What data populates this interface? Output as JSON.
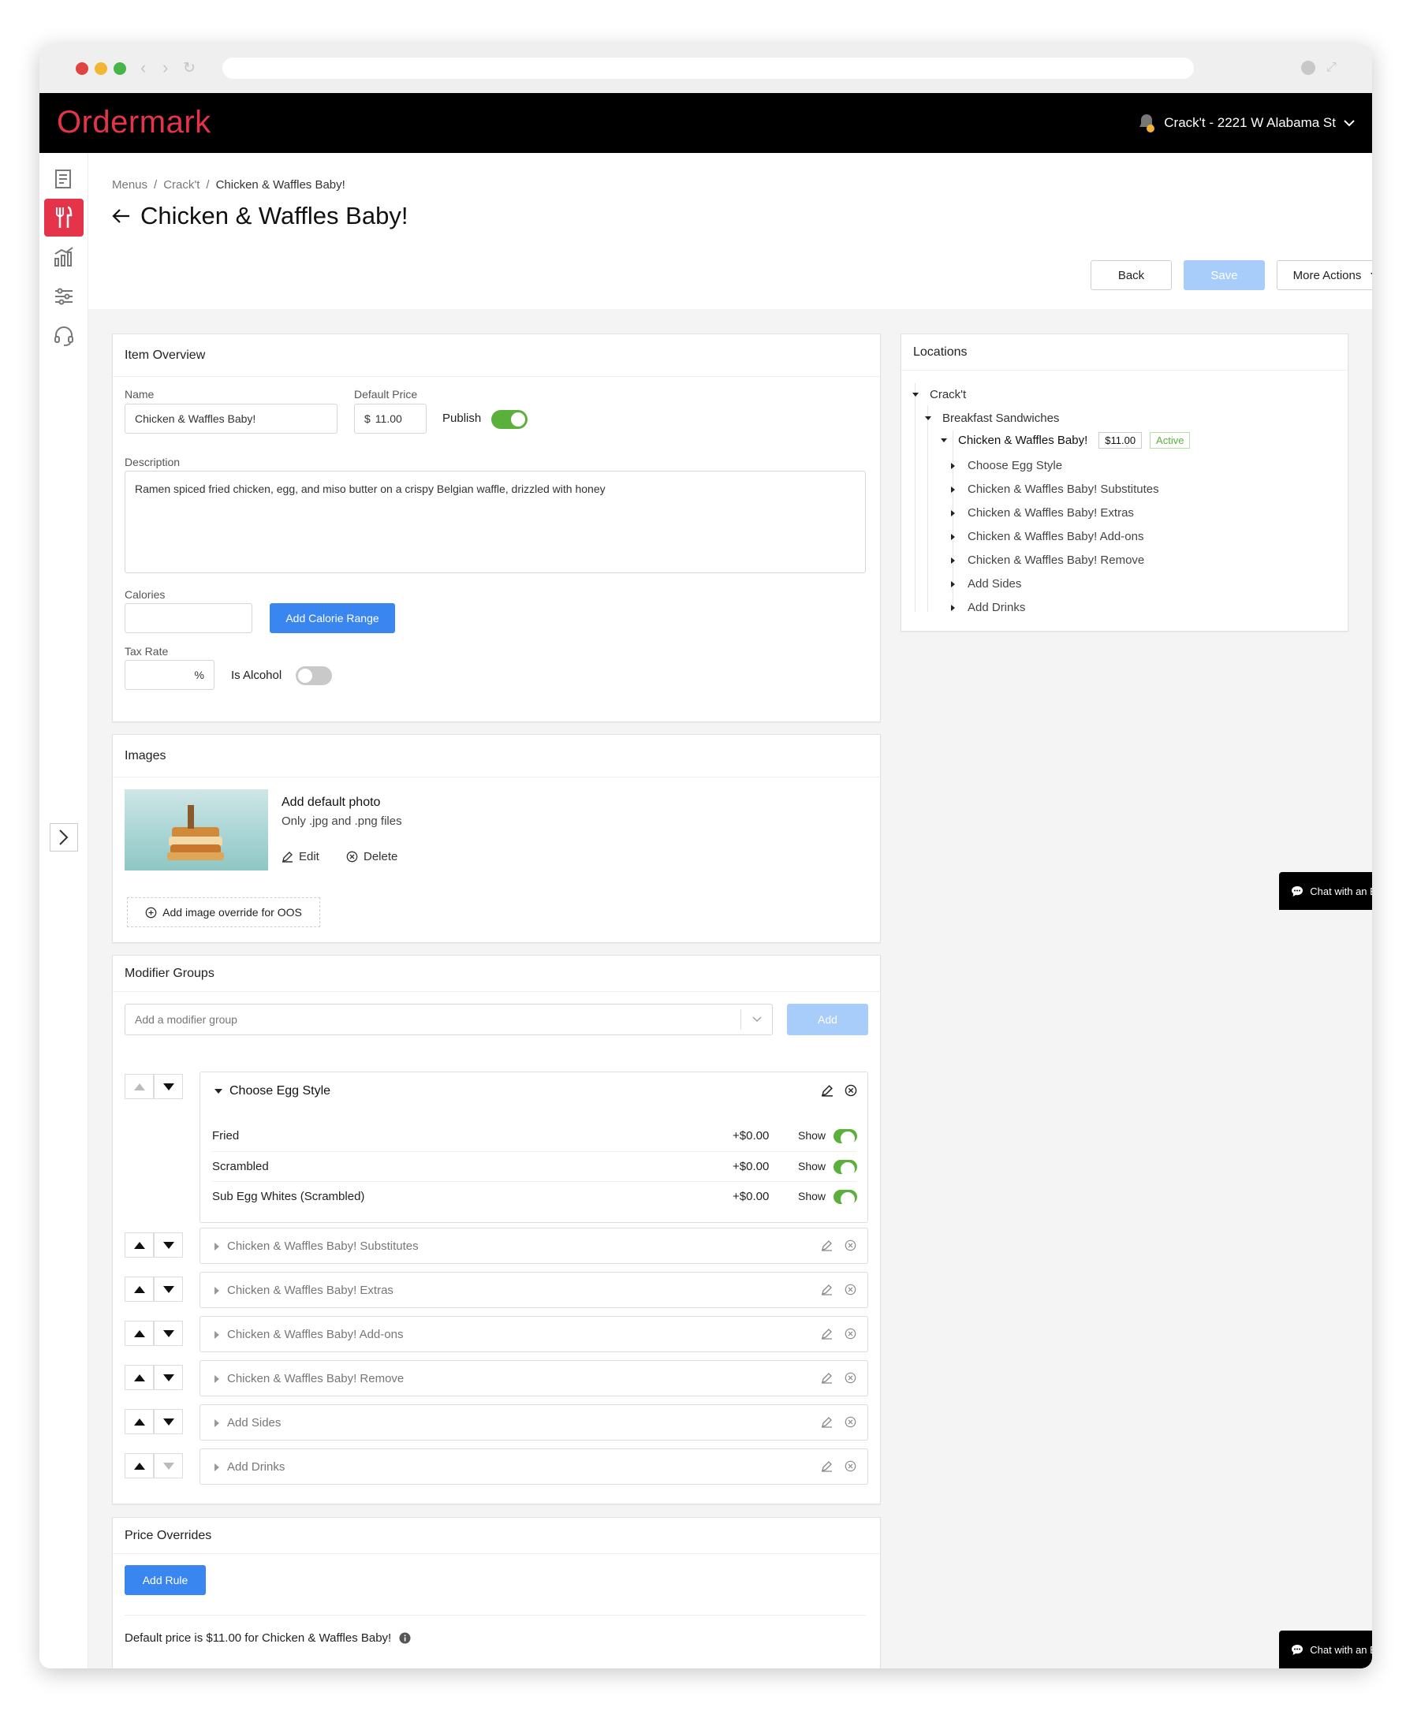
{
  "app": {
    "logo": "Ordermark",
    "location": "Crack't - 2221 W Alabama St"
  },
  "breadcrumb": {
    "menus": "Menus",
    "sep": "/",
    "brand": "Crack't",
    "item": "Chicken & Waffles Baby!"
  },
  "page": {
    "title": "Chicken & Waffles Baby!",
    "back_button": "Back",
    "save_button": "Save",
    "more_actions_button": "More Actions"
  },
  "overview": {
    "heading": "Item Overview",
    "name_label": "Name",
    "name_value": "Chicken & Waffles Baby!",
    "price_label": "Default Price",
    "price_currency": "$",
    "price_value": "11.00",
    "publish_label": "Publish",
    "description_label": "Description",
    "description_value": "Ramen spiced fried chicken, egg, and miso butter on a crispy Belgian waffle, drizzled with honey",
    "calories_label": "Calories",
    "add_calorie_range": "Add Calorie Range",
    "tax_label": "Tax Rate",
    "tax_unit": "%",
    "alcohol_label": "Is Alcohol"
  },
  "images": {
    "heading": "Images",
    "add_default": "Add default photo",
    "file_types": "Only .jpg and .png files",
    "edit": "Edit",
    "delete": "Delete",
    "oos_override": "Add image override for OOS"
  },
  "modifiers": {
    "heading": "Modifier Groups",
    "placeholder": "Add a modifier group",
    "add_button": "Add",
    "expanded_group": {
      "name": "Choose Egg Style",
      "options": [
        {
          "name": "Fried",
          "price": "+$0.00",
          "show": "Show"
        },
        {
          "name": "Scrambled",
          "price": "+$0.00",
          "show": "Show"
        },
        {
          "name": "Sub Egg Whites (Scrambled)",
          "price": "+$0.00",
          "show": "Show"
        }
      ]
    },
    "collapsed_groups": [
      "Chicken & Waffles Baby! Substitutes",
      "Chicken & Waffles Baby! Extras",
      "Chicken & Waffles Baby! Add-ons",
      "Chicken & Waffles Baby! Remove",
      "Add Sides",
      "Add Drinks"
    ]
  },
  "price_overrides": {
    "heading": "Price Overrides",
    "add_rule": "Add Rule",
    "default_note": "Default price is $11.00 for Chicken & Waffles Baby!"
  },
  "locations": {
    "heading": "Locations",
    "brand": "Crack't",
    "menu": "Breakfast Sandwiches",
    "item": "Chicken & Waffles Baby!",
    "item_price": "$11.00",
    "item_status": "Active",
    "groups": [
      "Choose Egg Style",
      "Chicken & Waffles Baby! Substitutes",
      "Chicken & Waffles Baby! Extras",
      "Chicken & Waffles Baby! Add-ons",
      "Chicken & Waffles Baby! Remove",
      "Add Sides",
      "Add Drinks"
    ]
  },
  "chat": {
    "label": "Chat with an Expert"
  },
  "colors": {
    "brand_red": "#e5344a",
    "primary_blue": "#3a86f0",
    "toggle_green": "#5ab03a",
    "active_green": "#5ab03a"
  }
}
